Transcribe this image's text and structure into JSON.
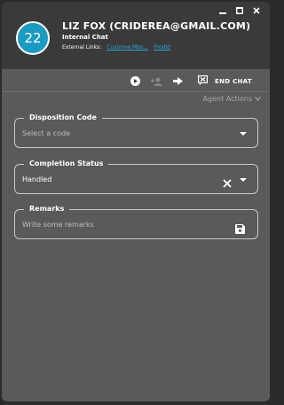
{
  "window": {
    "controls": [
      "minimize-icon",
      "maximize-icon",
      "close-icon"
    ]
  },
  "contact": {
    "avatar_text": "22",
    "name": "LIZ FOX (CRIDEREA@GMAIL.COM)",
    "chat_type": "Internal Chat",
    "external_links_label": "External Links:",
    "external_links": [
      "Custome Mbo...",
      "Prodid"
    ]
  },
  "toolbar": {
    "icons": [
      "play-icon",
      "transfer-agent-icon",
      "forward-icon"
    ],
    "end_chat_label": "END CHAT"
  },
  "agent_actions_label": "Agent Actions",
  "disposition": {
    "label": "Disposition Code",
    "placeholder": "Select a code"
  },
  "completion": {
    "label": "Completion Status",
    "value": "Handled"
  },
  "remarks": {
    "label": "Remarks",
    "placeholder": "Write some remarks"
  },
  "colors": {
    "accent": "#1b9bc2",
    "link": "#2aa7d6",
    "panel_bg": "#5a5a5a",
    "header_bg": "#3a3a3a"
  }
}
